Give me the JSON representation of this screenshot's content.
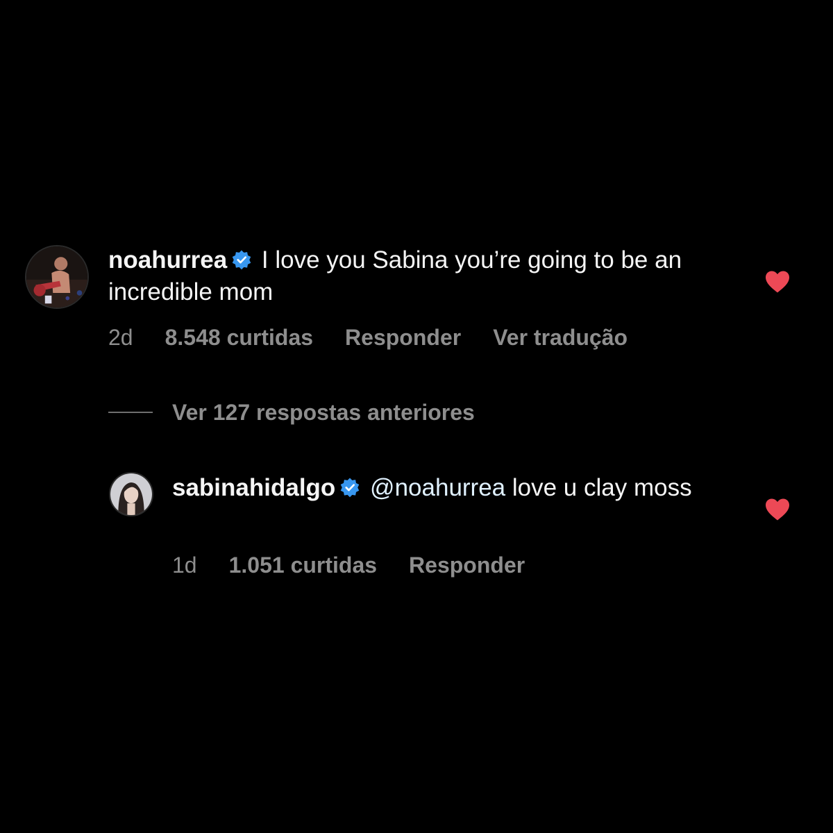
{
  "comment": {
    "username": "noahurrea",
    "verified_icon": "verified-badge-icon",
    "text": "I love you Sabina you’re going to be an incredible mom",
    "time": "2d",
    "likes": "8.548 curtidas",
    "reply_label": "Responder",
    "translate_label": "Ver tradução",
    "liked": true
  },
  "view_replies": {
    "label": "Ver 127 respostas anteriores"
  },
  "reply": {
    "username": "sabinahidalgo",
    "verified_icon": "verified-badge-icon",
    "mention": "@noahurrea",
    "text": " love u clay moss",
    "time": "1d",
    "likes": "1.051 curtidas",
    "reply_label": "Responder",
    "liked": true
  },
  "colors": {
    "background": "#000000",
    "text": "#f5f5f5",
    "meta": "#8e8e8e",
    "verified": "#3897f0",
    "heart": "#ed4956",
    "mention": "#e0f1ff"
  }
}
